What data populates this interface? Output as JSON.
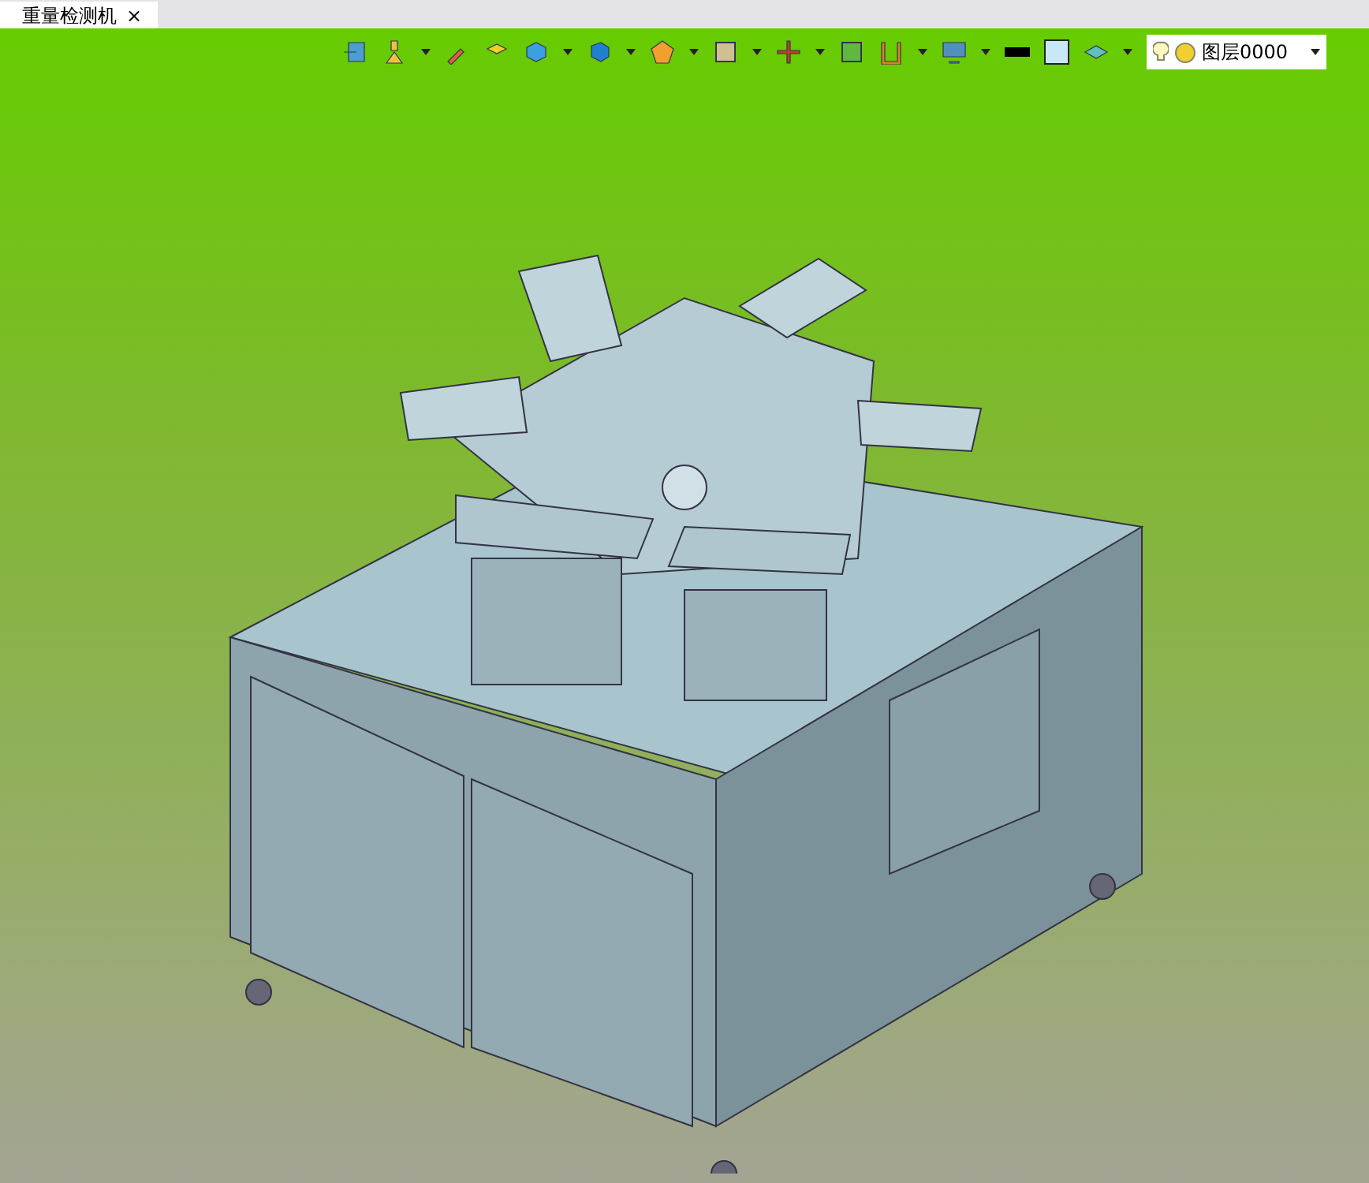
{
  "tab": {
    "title": "重量检测机",
    "close": "×",
    "selected": true
  },
  "layer_selector": {
    "value": "图层0000"
  }
}
